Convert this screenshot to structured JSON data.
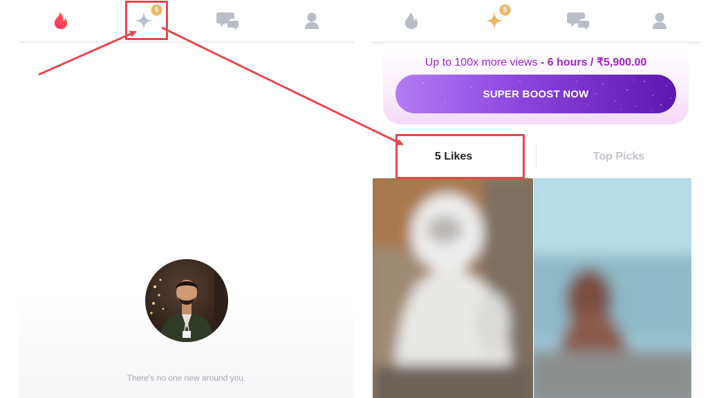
{
  "left_screen": {
    "nav": {
      "items": [
        {
          "name": "flame-icon",
          "active": true
        },
        {
          "name": "sparkle-icon",
          "active": false,
          "badge": "5"
        },
        {
          "name": "chat-bubbles-icon",
          "active": false
        },
        {
          "name": "profile-icon",
          "active": false
        }
      ]
    },
    "empty_state_text": "There's no one new around you."
  },
  "right_screen": {
    "nav": {
      "items": [
        {
          "name": "flame-icon",
          "active": false
        },
        {
          "name": "sparkle-icon",
          "active": true,
          "badge": "5"
        },
        {
          "name": "chat-bubbles-icon",
          "active": false
        },
        {
          "name": "profile-icon",
          "active": false
        }
      ]
    },
    "boost": {
      "prefix": "Up to 100x more views",
      "separator": " - ",
      "duration": "6 hours",
      "price_separator": " / ",
      "price": "₹5,900.00",
      "button_label": "SUPER BOOST NOW"
    },
    "tabs": [
      {
        "label": "5 Likes",
        "active": true
      },
      {
        "label": "Top Picks",
        "active": false
      }
    ]
  },
  "colors": {
    "flame_active": "#fd4b63",
    "sparkle_active": "#e9b96a",
    "icon_inactive": "#b8bdc6",
    "boost_text": "#9b24c9",
    "callout": "#e5484d"
  }
}
